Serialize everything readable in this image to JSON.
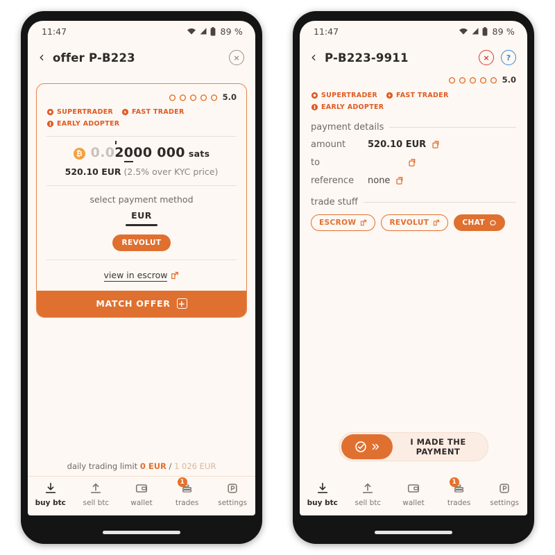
{
  "meta": {
    "accent": "#E0702F",
    "accent_light": "#E8834A",
    "screen_bg": "#FDF8F3",
    "red": "#E0352B",
    "blue": "#2F88E0"
  },
  "status_bar": {
    "time": "11:47",
    "battery": "89 %",
    "wifi_icon": "wifi-icon",
    "signal_icon": "signal-icon",
    "battery_icon": "battery-icon"
  },
  "left_phone": {
    "appbar": {
      "back_icon": "chevron-left-icon",
      "title": "offer P-B223",
      "close_icon": "close-circle-icon",
      "close_label": "×"
    },
    "card": {
      "rating": {
        "value": "5.0",
        "stars": 5,
        "star_icon": "rating-circle-icon"
      },
      "badges": [
        {
          "label": "SUPERTRADER",
          "icon": "supertrader-badge-icon"
        },
        {
          "label": "FAST TRADER",
          "icon": "fast-trader-badge-icon"
        },
        {
          "label": "EARLY ADOPTER",
          "icon": "early-adopter-badge-icon"
        }
      ],
      "amount": {
        "coin_icon": "bitcoin-icon",
        "coin_symbol": "₿",
        "dim_prefix": "0.0",
        "tick_digit": "2",
        "underline_digit": "0",
        "rest": "00 000",
        "unit": "sats"
      },
      "fiat": {
        "value": "520.10 EUR",
        "note": "(2.5% over KYC price)"
      },
      "select_payment_label": "select payment method",
      "currency_tab": "EUR",
      "payment_method": "REVOLUT",
      "escrow_link": {
        "label": "view in escrow",
        "icon": "external-link-icon"
      },
      "match_button": {
        "label": "MATCH OFFER",
        "icon": "plus-box-icon",
        "glyph": "+"
      }
    },
    "limit": {
      "label": "daily trading limit",
      "used": "0 EUR",
      "separator": "/",
      "max": "1 026 EUR"
    }
  },
  "right_phone": {
    "appbar": {
      "back_icon": "chevron-left-icon",
      "title": "P-B223-9911",
      "close_icon": "close-circle-icon",
      "close_label": "×",
      "help_icon": "help-circle-icon",
      "help_label": "?"
    },
    "rating": {
      "value": "5.0",
      "stars": 5,
      "star_icon": "rating-circle-icon"
    },
    "badges": [
      {
        "label": "SUPERTRADER",
        "icon": "supertrader-badge-icon"
      },
      {
        "label": "FAST TRADER",
        "icon": "fast-trader-badge-icon"
      },
      {
        "label": "EARLY ADOPTER",
        "icon": "early-adopter-badge-icon"
      }
    ],
    "payment_details": {
      "heading": "payment details",
      "rows": [
        {
          "key": "amount",
          "value": "520.10 EUR",
          "bold": true,
          "copy_icon": "copy-icon"
        },
        {
          "key": "to",
          "value": "",
          "bold": false,
          "copy_icon": "copy-icon"
        },
        {
          "key": "reference",
          "value": "none",
          "bold": false,
          "copy_icon": "copy-icon"
        }
      ]
    },
    "trade_stuff": {
      "heading": "trade stuff",
      "chips": [
        {
          "label": "ESCROW",
          "icon": "external-link-icon",
          "filled": false
        },
        {
          "label": "REVOLUT",
          "icon": "external-link-icon",
          "filled": false
        },
        {
          "label": "CHAT",
          "icon": "chat-bubble-icon",
          "filled": true
        }
      ]
    },
    "confirm_slider": {
      "label": "I MADE THE PAYMENT",
      "check_icon": "check-circle-icon",
      "chevrons_icon": "double-chevron-right-icon"
    }
  },
  "bottom_nav": {
    "items": [
      {
        "label": "buy btc",
        "icon": "download-arrow-icon",
        "active": true,
        "badge": ""
      },
      {
        "label": "sell btc",
        "icon": "upload-arrow-icon",
        "active": false,
        "badge": ""
      },
      {
        "label": "wallet",
        "icon": "wallet-icon",
        "active": false,
        "badge": ""
      },
      {
        "label": "trades",
        "icon": "coins-stack-icon",
        "active": false,
        "badge": "1"
      },
      {
        "label": "settings",
        "icon": "settings-p-icon",
        "active": false,
        "badge": ""
      }
    ]
  }
}
